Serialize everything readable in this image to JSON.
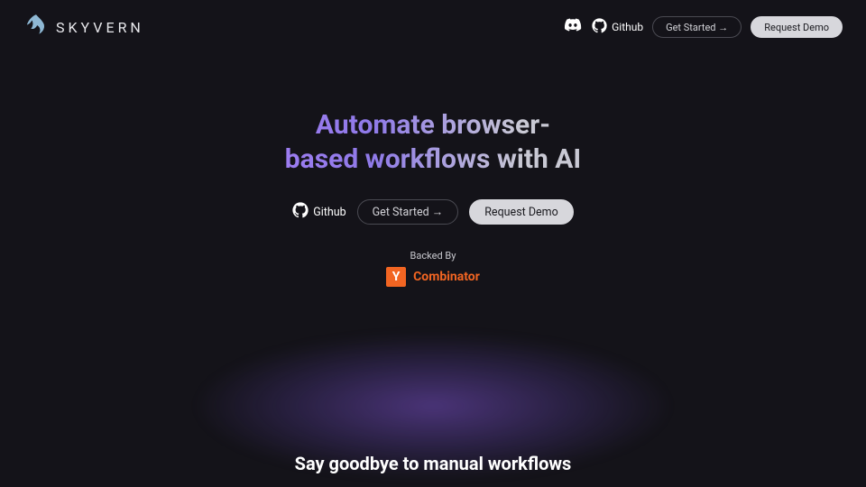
{
  "brand": {
    "name": "SKYVERN"
  },
  "header": {
    "github_label": "Github",
    "get_started_label": "Get Started →",
    "request_demo_label": "Request Demo"
  },
  "hero": {
    "headline": "Automate browser-\nbased workflows with AI",
    "github_label": "Github",
    "get_started_label": "Get Started →",
    "request_demo_label": "Request Demo",
    "backed_by_label": "Backed By",
    "yc_letter": "Y",
    "combinator_label": "Combinator"
  },
  "section2": {
    "heading": "Say goodbye to manual workflows"
  }
}
